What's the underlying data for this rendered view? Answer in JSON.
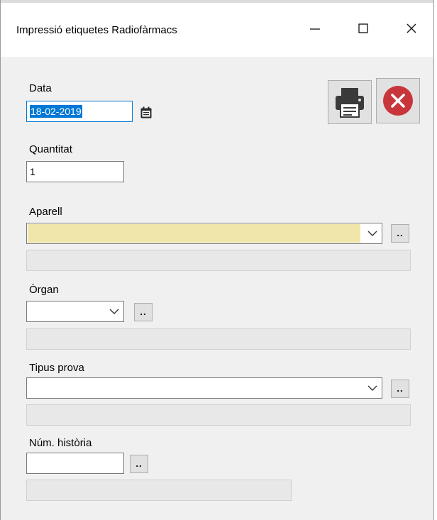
{
  "window": {
    "title": "Impressió etiquetes Radiofàrmacs",
    "minimize_glyph": "—",
    "maximize_glyph": "☐",
    "close_glyph": "✕"
  },
  "form": {
    "data_label": "Data",
    "data_value": "18-02-2019",
    "quantitat_label": "Quantitat",
    "quantitat_value": "1",
    "aparell_label": "Aparell",
    "aparell_value": "",
    "organ_label": "Òrgan",
    "organ_value": "",
    "tipus_label": "Tipus prova",
    "tipus_value": "",
    "historia_label": "Núm. història",
    "historia_value": "",
    "lookup_label": ".."
  },
  "icons": {
    "calendar": "calendar-icon",
    "print": "printer-icon",
    "cancel": "cancel-icon",
    "dropdown": "chevron-down-icon"
  },
  "colors": {
    "aparell_highlight": "#f0e6aa",
    "cancel_red": "#c8363b",
    "selection": "#0078d7"
  }
}
